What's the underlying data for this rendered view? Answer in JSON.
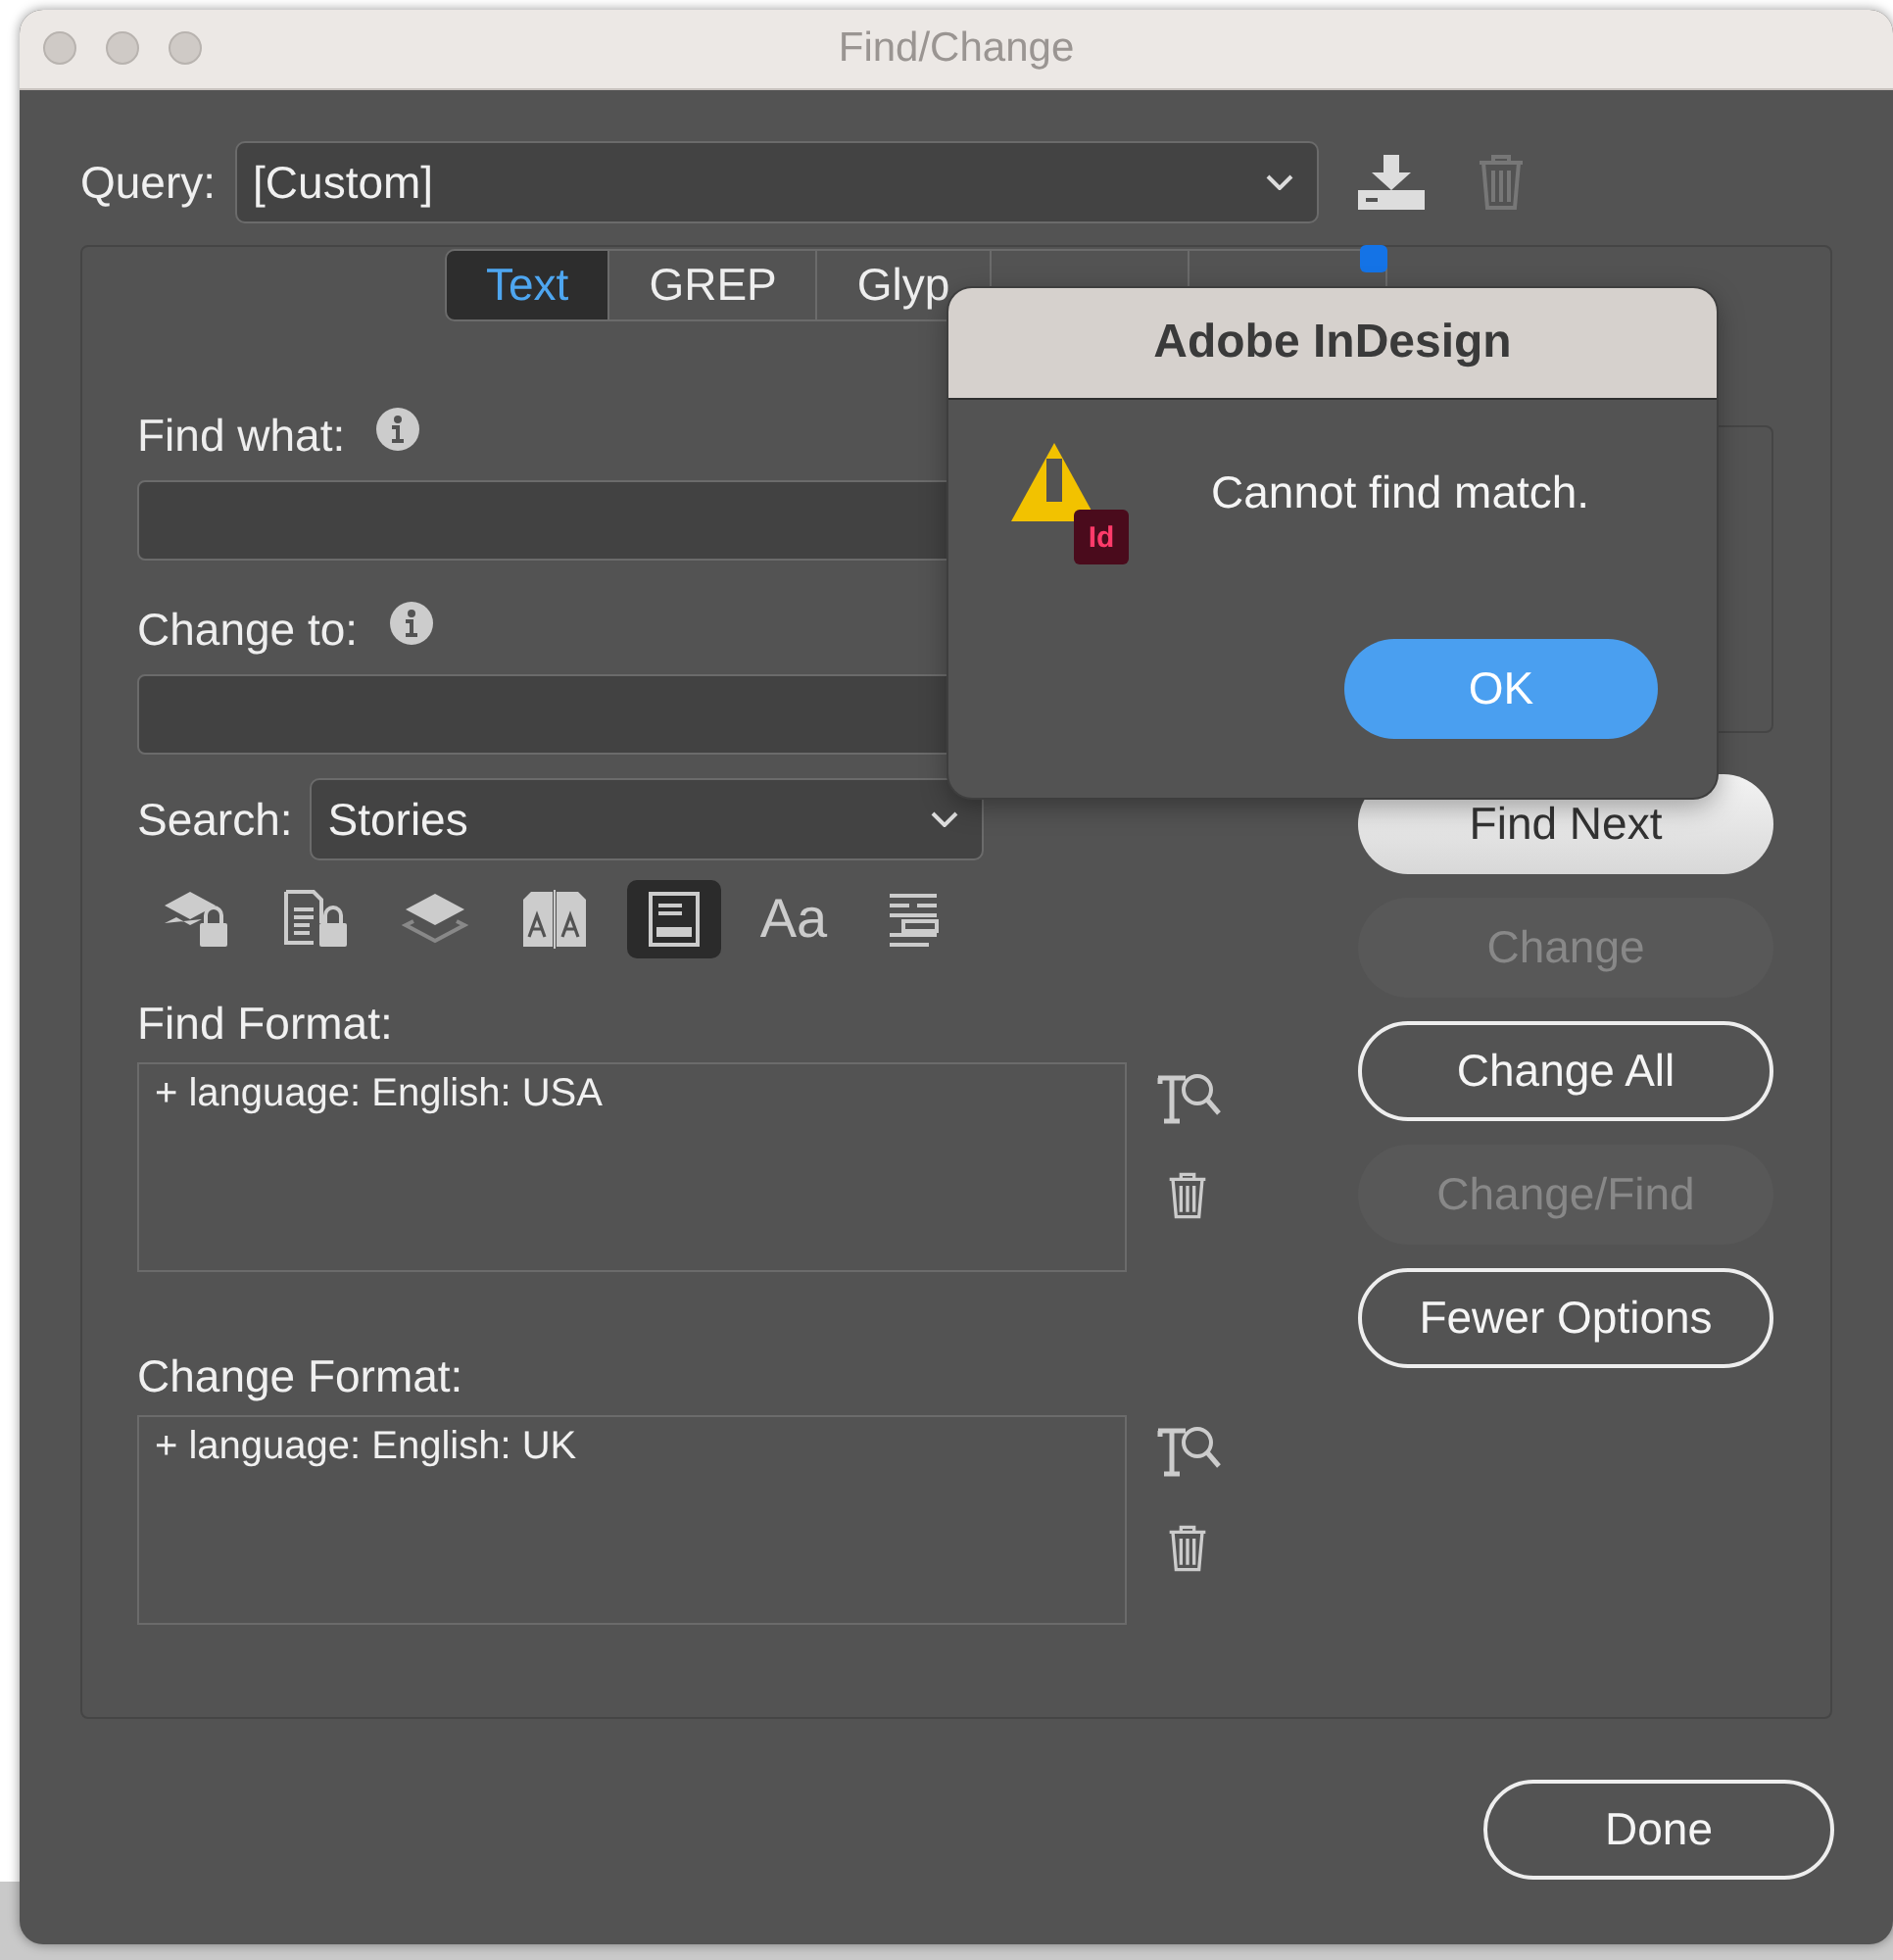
{
  "window": {
    "title": "Find/Change"
  },
  "query": {
    "label": "Query:",
    "value": "[Custom]"
  },
  "tabs": [
    {
      "label": "Text",
      "selected": true,
      "badge": false
    },
    {
      "label": "GREP",
      "selected": false,
      "badge": false
    },
    {
      "label": "Glyp",
      "selected": false,
      "badge": false
    },
    {
      "selected": false,
      "badge": false
    },
    {
      "selected": false,
      "badge": true
    }
  ],
  "find_what": {
    "label": "Find what:"
  },
  "change_to": {
    "label": "Change to:"
  },
  "search": {
    "label": "Search:",
    "value": "Stories"
  },
  "options": [
    {
      "kind": "locked-layers",
      "selected": false
    },
    {
      "kind": "locked-stories",
      "selected": false
    },
    {
      "kind": "hidden-layers",
      "selected": false
    },
    {
      "kind": "master-pages",
      "selected": false
    },
    {
      "kind": "footnotes",
      "selected": true
    },
    {
      "kind": "case",
      "label": "Aa",
      "selected": false
    },
    {
      "kind": "whole-word",
      "selected": false
    }
  ],
  "find_format": {
    "label": "Find Format:",
    "value": "+ language: English: USA"
  },
  "change_format": {
    "label": "Change Format:",
    "value": "+ language: English: UK"
  },
  "buttons": [
    {
      "label": "Find Next",
      "kind": "default",
      "disabled": false
    },
    {
      "label": "Change",
      "kind": "outline",
      "disabled": true
    },
    {
      "label": "Change All",
      "kind": "outline",
      "disabled": false
    },
    {
      "label": "Change/Find",
      "kind": "outline",
      "disabled": true
    },
    {
      "label": "Fewer Options",
      "kind": "outline",
      "disabled": false
    }
  ],
  "done": {
    "label": "Done"
  },
  "alert": {
    "title": "Adobe InDesign",
    "badge": "Id",
    "message": "Cannot find match.",
    "button": "OK"
  }
}
